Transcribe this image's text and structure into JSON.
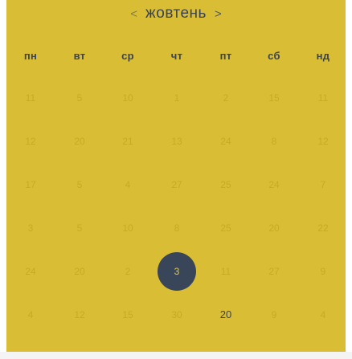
{
  "header": {
    "prev_label": "<",
    "next_label": ">",
    "month": "жовтень"
  },
  "weekdays": [
    "пн",
    "вт",
    "ср",
    "чт",
    "пт",
    "сб",
    "нд"
  ],
  "weeks": [
    [
      "11",
      "5",
      "10",
      "1",
      "2",
      "15",
      "11"
    ],
    [
      "12",
      "20",
      "21",
      "13",
      "24",
      "8",
      "12"
    ],
    [
      "17",
      "5",
      "4",
      "27",
      "25",
      "24",
      "7"
    ],
    [
      "3",
      "5",
      "10",
      "8",
      "25",
      "20",
      "22"
    ],
    [
      "24",
      "20",
      "2",
      "3",
      "11",
      "27",
      "9"
    ],
    [
      "4",
      "12",
      "15",
      "30",
      "20",
      "9",
      "4"
    ]
  ],
  "selected_day": "3",
  "highlighted_day": "20",
  "colors": {
    "background": "#d9bd34",
    "text_dark": "#3a4352",
    "text_faint": "#c8ab22",
    "selected_circle": "#39465a"
  }
}
